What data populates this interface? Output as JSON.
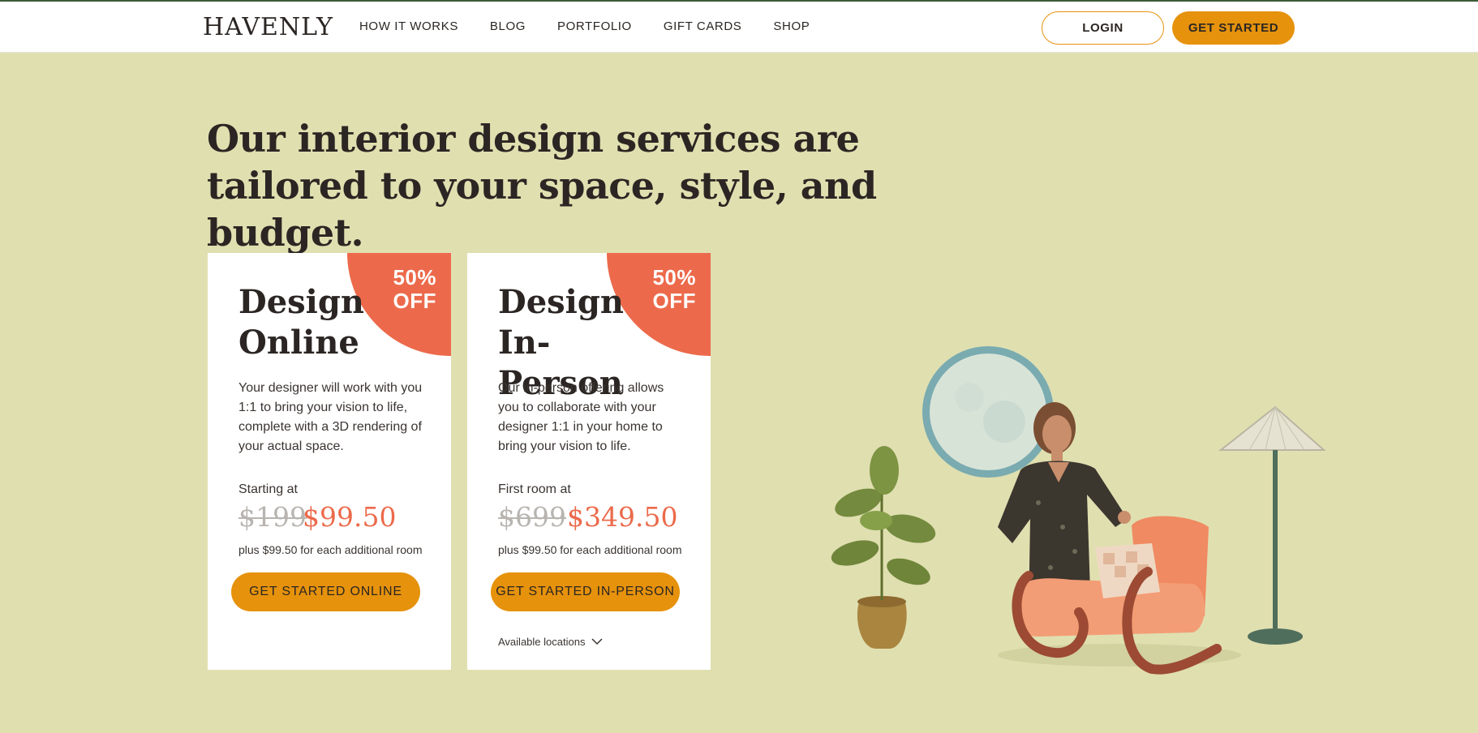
{
  "header": {
    "logo": "HAVENLY",
    "nav": [
      "HOW IT WORKS",
      "BLOG",
      "PORTFOLIO",
      "GIFT CARDS",
      "SHOP"
    ],
    "login_label": "LOGIN",
    "get_started_label": "GET STARTED"
  },
  "hero": {
    "headline": "Our interior design services are tailored to your space, style, and budget."
  },
  "cards": [
    {
      "badge_line1": "50%",
      "badge_line2": "OFF",
      "title_line1": "Design",
      "title_line2": "Online",
      "description": "Your designer will work with you 1:1 to bring your vision to life, complete with a 3D rendering of your actual space.",
      "price_label": "Starting at",
      "old_price": "$199",
      "new_price": "$99.50",
      "additional": "plus $99.50 for each additional room",
      "button": "GET STARTED ONLINE"
    },
    {
      "badge_line1": "50%",
      "badge_line2": "OFF",
      "title_line1": "Design",
      "title_line2": "In-Person",
      "description": "Our in-person offering allows you to collaborate with your designer 1:1 in your home to bring your vision to life.",
      "price_label": "First room at",
      "old_price": "$699",
      "new_price": "$349.50",
      "additional": "plus $99.50 for each additional room",
      "button": "GET STARTED IN-PERSON",
      "locations_link": "Available locations"
    }
  ],
  "colors": {
    "background": "#e0dfb0",
    "accent_orange": "#e6920c",
    "badge_coral": "#ec6a4b",
    "text_dark": "#2b2623"
  },
  "icons": {
    "locations_chevron": "chevron-down-icon"
  }
}
